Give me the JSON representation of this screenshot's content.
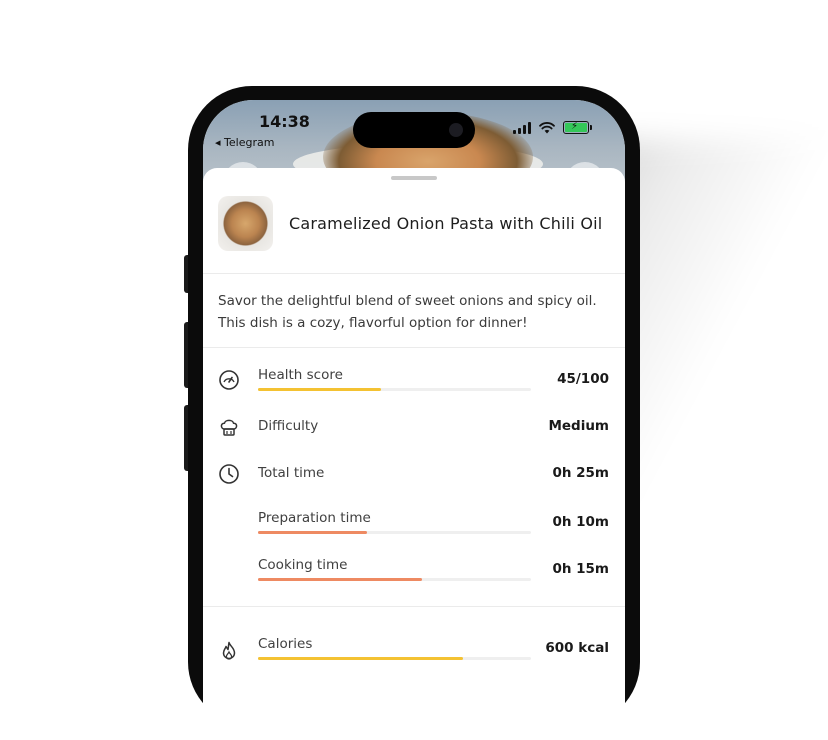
{
  "status_bar": {
    "time": "14:38",
    "back_app": "◂ Telegram"
  },
  "recipe": {
    "title": "Caramelized Onion Pasta with Chili Oil",
    "description": "Savor the delightful blend of sweet onions and spicy oil. This dish is a cozy, flavorful option for dinner!"
  },
  "stats": {
    "health": {
      "label": "Health score",
      "value": "45/100",
      "progress": 0.45,
      "icon": "gauge-icon",
      "color": "#f4c232"
    },
    "difficulty": {
      "label": "Difficulty",
      "value": "Medium",
      "icon": "chef-hat-icon"
    },
    "total_time": {
      "label": "Total time",
      "value": "0h 25m",
      "icon": "clock-icon"
    },
    "prep_time": {
      "label": "Preparation time",
      "value": "0h 10m",
      "progress": 0.4,
      "color": "#ee8a62"
    },
    "cook_time": {
      "label": "Cooking time",
      "value": "0h 15m",
      "progress": 0.6,
      "color": "#ee8a62"
    },
    "calories": {
      "label": "Calories",
      "value": "600 kcal",
      "progress": 0.75,
      "icon": "flame-icon",
      "color": "#f4c232"
    }
  }
}
